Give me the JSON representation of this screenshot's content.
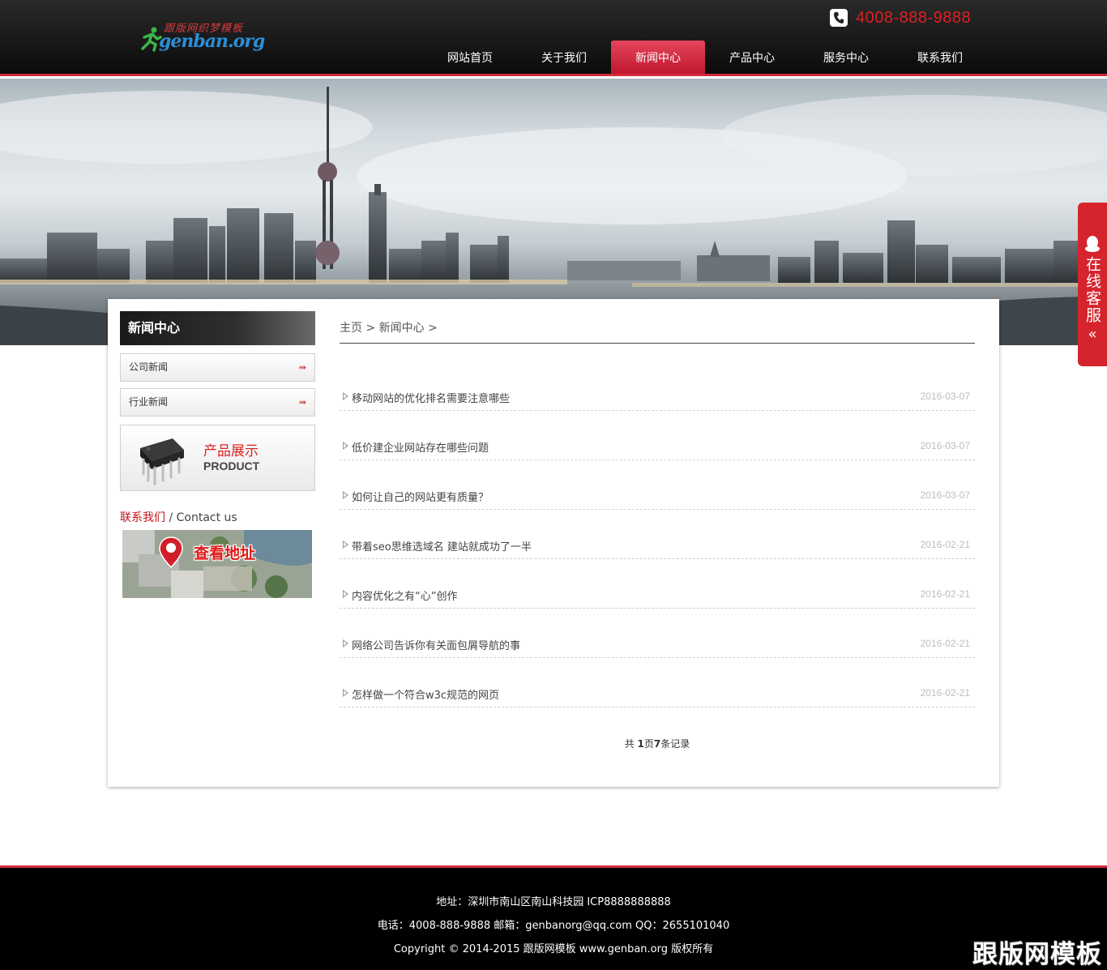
{
  "header": {
    "logo_top": "跟版网织梦模板",
    "logo_main": "genban.org",
    "phone": "4008-888-9888"
  },
  "nav": [
    {
      "label": "网站首页"
    },
    {
      "label": "关于我们"
    },
    {
      "label": "新闻中心"
    },
    {
      "label": "产品中心"
    },
    {
      "label": "服务中心"
    },
    {
      "label": "联系我们"
    }
  ],
  "nav_active": "新闻中心",
  "float_service": {
    "label": "在线客服",
    "arrow": "«"
  },
  "sidebar": {
    "title": "新闻中心",
    "items": [
      {
        "label": "公司新闻",
        "arrow": "⇛"
      },
      {
        "label": "行业新闻",
        "arrow": "⇛"
      }
    ],
    "product": {
      "cn": "产品展示",
      "en": "PRODUCT"
    },
    "contact": {
      "cn": "联系我们",
      "en": " / Contact us"
    },
    "map_label": "查看地址"
  },
  "breadcrumb": "主页 > 新闻中心 >",
  "news": [
    {
      "title": "移动网站的优化排名需要注意哪些",
      "date": "2016-03-07"
    },
    {
      "title": "低价建企业网站存在哪些问题",
      "date": "2016-03-07"
    },
    {
      "title": "如何让自己的网站更有质量？",
      "date": "2016-03-07"
    },
    {
      "title": "带着seo思维选域名 建站就成功了一半",
      "date": "2016-02-21"
    },
    {
      "title": "内容优化之有“心”创作",
      "date": "2016-02-21"
    },
    {
      "title": "网络公司告诉你有关面包屑导航的事",
      "date": "2016-02-21"
    },
    {
      "title": "怎样做一个符合w3c规范的网页",
      "date": "2016-02-21"
    }
  ],
  "pager": {
    "prefix": "共 ",
    "pages": "1",
    "mid": "页",
    "records": "7",
    "suffix": "条记录"
  },
  "footer": {
    "line1": "地址：深圳市南山区南山科技园    ICP8888888888",
    "line2": "电话：4008-888-9888    邮箱：genbanorg@qq.com    QQ：2655101040",
    "line3": "Copyright © 2014-2015 跟版网模板 www.genban.org 版权所有"
  },
  "watermark": "跟版网模板",
  "colors": {
    "accent": "#d22a3c",
    "phone": "#e02020",
    "float": "#d5242d"
  }
}
